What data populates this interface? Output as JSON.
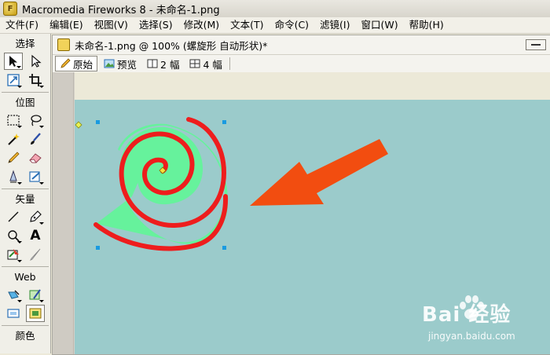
{
  "app": {
    "title": "Macromedia Fireworks 8 - 未命名-1.png",
    "logo_letter": "F"
  },
  "menu": [
    "文件(F)",
    "编辑(E)",
    "视图(V)",
    "选择(S)",
    "修改(M)",
    "文本(T)",
    "命令(C)",
    "滤镜(I)",
    "窗口(W)",
    "帮助(H)"
  ],
  "tools": {
    "sections": {
      "select": "选择",
      "bitmap": "位图",
      "vector": "矢量",
      "web": "Web",
      "colors": "颜色"
    },
    "text_tool_glyph": "A"
  },
  "document": {
    "title": "未命名-1.png @ 100% (螺旋形 自动形状)*",
    "tabs": {
      "original": "原始",
      "preview": "预览",
      "two_up": "2 幅",
      "four_up": "4 幅"
    },
    "active_tab": "original"
  },
  "colors": {
    "canvas": "#9bcbcb",
    "spiral_fill": "#66f29c",
    "spiral_stroke": "#ee1d1d",
    "arrow": "#f24d10",
    "handle": "#1a9be0"
  },
  "watermark": {
    "brand": "Bai 经验",
    "url": "jingyan.baidu.com"
  }
}
